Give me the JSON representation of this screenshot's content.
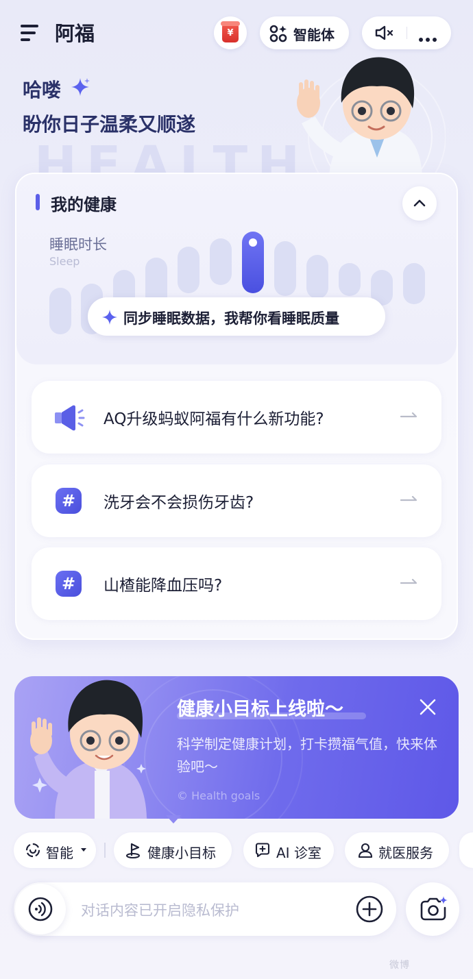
{
  "header": {
    "app_title": "阿福",
    "coin_badge": "¥",
    "agent_label": "智能体",
    "icons": [
      "menu-icon",
      "coin-jar-icon",
      "grid-icon",
      "mute-icon",
      "more-icon"
    ]
  },
  "greeting": {
    "hello": "哈喽",
    "subtitle": "盼你日子温柔又顺遂",
    "watermark": "HEALTH"
  },
  "health_card": {
    "title": "我的健康",
    "metric_label": "睡眠时长",
    "metric_label_en": "Sleep",
    "sync_prompt": "同步睡眠数据，我帮你看睡眠质量"
  },
  "questions": [
    {
      "text": "AQ升级蚂蚁阿福有什么新功能?",
      "icon": "speaker-icon"
    },
    {
      "text": "洗牙会不会损伤牙齿?",
      "icon": "hash-icon"
    },
    {
      "text": "山楂能降血压吗?",
      "icon": "hash-icon"
    }
  ],
  "banner": {
    "title": "健康小目标上线啦～",
    "description": "科学制定健康计划，打卡攒福气值，快来体验吧～",
    "footer": "© Health goals"
  },
  "chips": [
    {
      "label": "智能",
      "icon": "smart-mode-icon",
      "has_dropdown": true
    },
    {
      "label": "健康小目标",
      "icon": "goal-flag-icon"
    },
    {
      "label": "AI 诊室",
      "icon": "chat-plus-icon"
    },
    {
      "label": "就医服务",
      "icon": "doctor-icon"
    }
  ],
  "input": {
    "placeholder": "对话内容已开启隐私保护"
  },
  "watermark_mark": "微博",
  "colors": {
    "accent": "#5b5ee8",
    "text_dark": "#1c1f35",
    "banner_start": "#a9a2f4",
    "banner_end": "#5e58e8"
  }
}
